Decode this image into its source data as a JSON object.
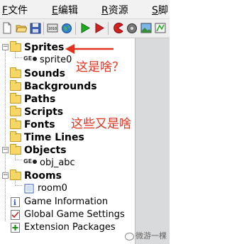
{
  "menubar": {
    "items": [
      {
        "accel": "F",
        "label": "文件"
      },
      {
        "accel": "E",
        "label": "编辑"
      },
      {
        "accel": "R",
        "label": "资源"
      },
      {
        "accel": "S",
        "label": "脚"
      }
    ]
  },
  "toolbar": {
    "icons": [
      "new-file-icon",
      "open-folder-icon",
      "save-icon",
      "separator",
      "create-executable-icon",
      "publish-globe-icon",
      "separator",
      "run-icon",
      "debug-run-icon",
      "separator",
      "add-sprite-icon",
      "add-sound-icon",
      "add-background-icon"
    ]
  },
  "tree": {
    "sprites": "Sprites",
    "sprite0": "sprite0",
    "sounds": "Sounds",
    "backgrounds": "Backgrounds",
    "paths": "Paths",
    "scripts": "Scripts",
    "fonts": "Fonts",
    "timelines": "Time Lines",
    "objects": "Objects",
    "obj_abc": "obj_abc",
    "rooms": "Rooms",
    "room0": "room0",
    "game_information": "Game Information",
    "global_game_settings": "Global Game Settings",
    "extension_packages": "Extension Packages",
    "ge_badge": "GE",
    "expanded": "−"
  },
  "annotations": {
    "sprites_question": "这是啥？",
    "others_question": "这些又是啥"
  },
  "watermark": "微游一棵",
  "colors": {
    "annotation": "#e0321e",
    "folder": "#f6d765",
    "panel": "#d9dadb"
  }
}
